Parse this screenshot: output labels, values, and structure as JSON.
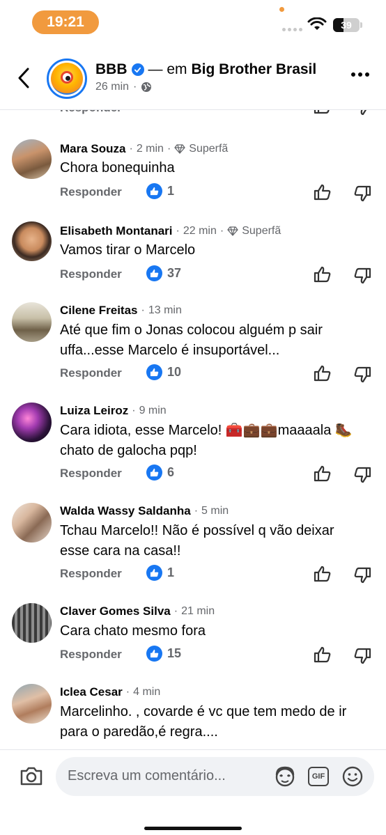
{
  "status_bar": {
    "time": "19:21",
    "battery": "39",
    "battery_level": 0.39
  },
  "header": {
    "page_name": "BBB",
    "connector": "— em",
    "group_name": "Big Brother Brasil",
    "time_ago": "26 min",
    "separator": "·"
  },
  "comments_list": {
    "reply_label": "Responder",
    "items": [
      {
        "name": "Mara Souza",
        "time": "2 min",
        "badge": "Superfã",
        "text": "Chora bonequinha",
        "likes": "1"
      },
      {
        "name": "Elisabeth Montanari",
        "time": "22 min",
        "badge": "Superfã",
        "text": "Vamos tirar o Marcelo",
        "likes": "37"
      },
      {
        "name": "Cilene Freitas",
        "time": "13 min",
        "badge": "",
        "text": "Até que fim o Jonas colocou alguém p sair uffa...esse Marcelo é insuportável...",
        "likes": "10"
      },
      {
        "name": "Luiza Leiroz",
        "time": "9 min",
        "badge": "",
        "text_before": "Cara idiota, esse Marcelo!",
        "emoji_1": "🧰💼💼",
        "text_middle": "maaaala",
        "emoji_2": "🥾",
        "text_after": "chato de galocha pqp!",
        "likes": "6"
      },
      {
        "name": "Walda Wassy Saldanha",
        "time": "5 min",
        "badge": "",
        "text": "Tchau Marcelo!! Não é possível q vão deixar esse cara na casa!!",
        "likes": "1"
      },
      {
        "name": "Claver Gomes Silva",
        "time": "21 min",
        "badge": "",
        "text": "Cara chato mesmo fora",
        "likes": "15"
      },
      {
        "name": "Iclea Cesar",
        "time": "4 min",
        "badge": "",
        "text": "Marcelinho. , covarde é vc que tem medo de ir para o  paredão,é regra....",
        "likes": ""
      }
    ]
  },
  "composer": {
    "placeholder": "Escreva um comentário...",
    "gif_label": "GIF"
  },
  "colors": {
    "accent": "#1877f2",
    "time_pill": "#f19a3e",
    "secondary_text": "#65676b"
  }
}
